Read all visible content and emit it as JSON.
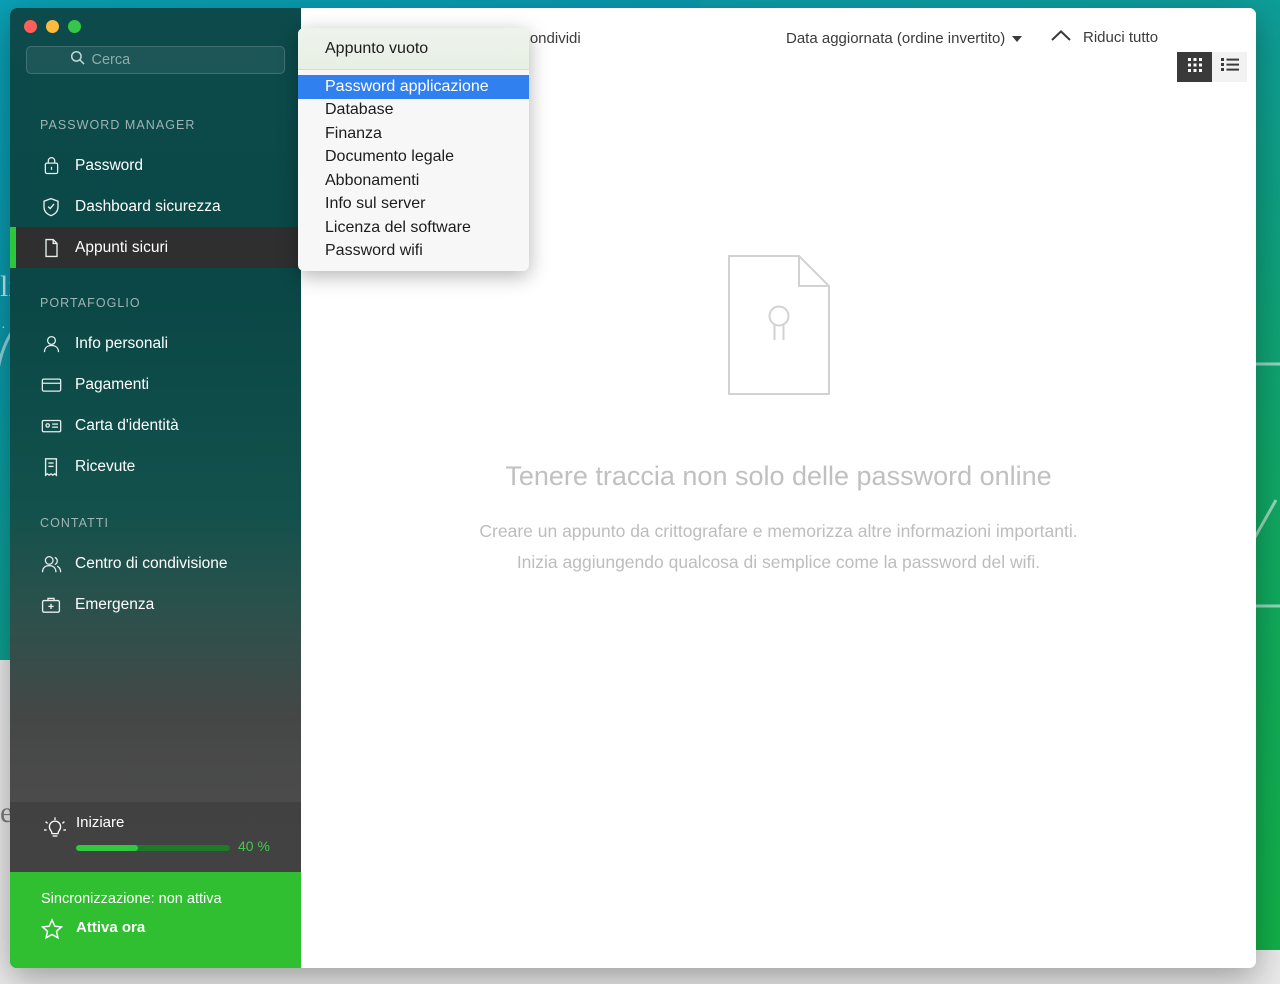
{
  "window": {
    "traffic_lights": [
      "close",
      "minimize",
      "zoom"
    ],
    "colors": {
      "close": "#fc6058",
      "minimize": "#fcbb40",
      "zoom": "#34c749",
      "accent_green": "#2fbf30",
      "menu_selection": "#3080f0",
      "sidebar_top": "#0d4a4c",
      "sidebar_bottom": "#4d4d4d"
    }
  },
  "search": {
    "placeholder": "Cerca",
    "value": "",
    "icon": "search-icon"
  },
  "sidebar": {
    "sections": [
      {
        "title": "PASSWORD MANAGER",
        "items": [
          {
            "label": "Password",
            "icon": "lock-icon",
            "active": false
          },
          {
            "label": "Dashboard sicurezza",
            "icon": "shield-check-icon",
            "active": false
          },
          {
            "label": "Appunti sicuri",
            "icon": "note-icon",
            "active": true
          }
        ]
      },
      {
        "title": "PORTAFOGLIO",
        "items": [
          {
            "label": "Info personali",
            "icon": "person-icon",
            "active": false
          },
          {
            "label": "Pagamenti",
            "icon": "credit-card-icon",
            "active": false
          },
          {
            "label": "Carta d'identità",
            "icon": "id-card-icon",
            "active": false
          },
          {
            "label": "Ricevute",
            "icon": "receipt-icon",
            "active": false
          }
        ]
      },
      {
        "title": "CONTATTI",
        "items": [
          {
            "label": "Centro di condivisione",
            "icon": "people-icon",
            "active": false
          },
          {
            "label": "Emergenza",
            "icon": "briefcase-plus-icon",
            "active": false
          }
        ]
      }
    ],
    "onboarding": {
      "icon": "lightbulb-icon",
      "title": "Iniziare",
      "progress_percent": 40,
      "progress_label": "40 %"
    },
    "sync": {
      "status_text": "Sincronizzazione: non attiva",
      "action_label": "Attiva ora",
      "icon": "star-icon"
    }
  },
  "toolbar": {
    "share_label": "Condividi",
    "sort_label": "Data aggiornata (ordine invertito)",
    "sort_icon": "chevron-down-icon",
    "collapse_label": "Riduci tutto",
    "collapse_icon": "chevron-up-icon",
    "views": [
      {
        "name": "grid-view",
        "icon": "grid-icon",
        "active": true
      },
      {
        "name": "list-view",
        "icon": "list-icon",
        "active": false
      }
    ]
  },
  "empty_state": {
    "icon": "document-keyhole-icon",
    "title": "Tenere traccia non solo delle password online",
    "description": "Creare un appunto da crittografare e memorizza altre informazioni importanti. Inizia aggiungendo qualcosa di semplice come la password del wifi."
  },
  "menu": {
    "header_label": "Appunto vuoto",
    "items": [
      {
        "label": "Password applicazione",
        "selected": true
      },
      {
        "label": "Database",
        "selected": false
      },
      {
        "label": "Finanza",
        "selected": false
      },
      {
        "label": "Documento legale",
        "selected": false
      },
      {
        "label": "Abbonamenti",
        "selected": false
      },
      {
        "label": "Info sul server",
        "selected": false
      },
      {
        "label": "Licenza del software",
        "selected": false
      },
      {
        "label": "Password wifi",
        "selected": false
      }
    ]
  },
  "desktop": {
    "background_glyphs": [
      "li",
      "e"
    ]
  }
}
